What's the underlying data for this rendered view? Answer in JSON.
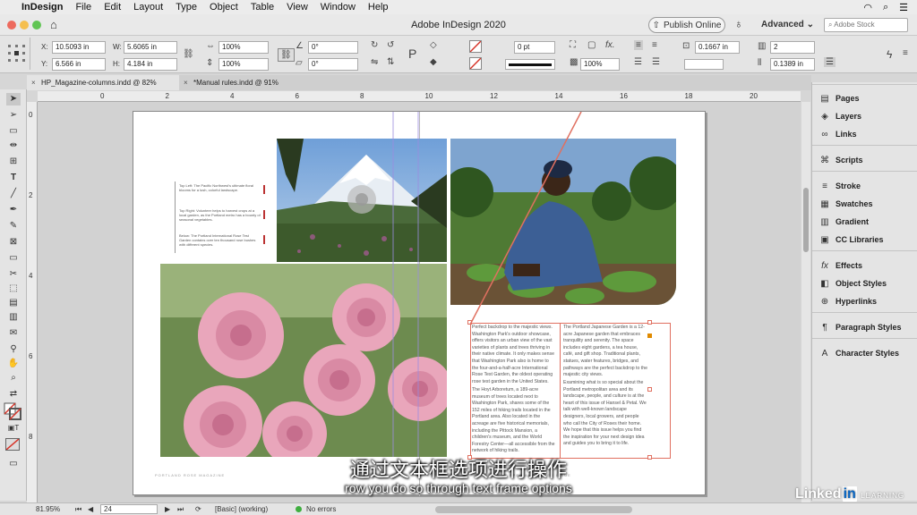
{
  "menubar": {
    "app": "InDesign",
    "items": [
      "File",
      "Edit",
      "Layout",
      "Type",
      "Object",
      "Table",
      "View",
      "Window",
      "Help"
    ]
  },
  "titlebar": {
    "title": "Adobe InDesign 2020",
    "publish_label": "Publish Online",
    "workspace": "Advanced",
    "stock_placeholder": "Adobe Stock"
  },
  "control": {
    "x_label": "X:",
    "x_value": "10.5093 in",
    "y_label": "Y:",
    "y_value": "6.566 in",
    "w_label": "W:",
    "w_value": "5.6065 in",
    "h_label": "H:",
    "h_value": "4.184 in",
    "scale_x": "100%",
    "scale_y": "100%",
    "rotate": "0°",
    "shear": "0°",
    "stroke_weight": "0 pt",
    "opacity": "100%",
    "inset_1": "0.1667 in",
    "inset_2": "0.1389 in",
    "columns": "2"
  },
  "tabs": [
    {
      "label": "HP_Magazine-columns.indd @ 82%",
      "active": true
    },
    {
      "label": "*Manual rules.indd @ 91%",
      "active": false
    }
  ],
  "rulers": {
    "h_ticks": [
      "0",
      "2",
      "4",
      "6",
      "8",
      "10",
      "12",
      "14",
      "16",
      "18",
      "20"
    ],
    "v_ticks": [
      "0",
      "2",
      "4",
      "6",
      "8"
    ]
  },
  "panels": [
    {
      "label": "Pages",
      "icon": "pages-icon",
      "glyph": "▤"
    },
    {
      "label": "Layers",
      "icon": "layers-icon",
      "glyph": "◈"
    },
    {
      "label": "Links",
      "icon": "links-icon",
      "glyph": "∞"
    },
    {
      "label": "Scripts",
      "icon": "scripts-icon",
      "glyph": "⌘"
    },
    {
      "label": "Stroke",
      "icon": "stroke-icon",
      "glyph": "≡"
    },
    {
      "label": "Swatches",
      "icon": "swatches-icon",
      "glyph": "▦"
    },
    {
      "label": "Gradient",
      "icon": "gradient-icon",
      "glyph": "▥"
    },
    {
      "label": "CC Libraries",
      "icon": "cc-libraries-icon",
      "glyph": "▣"
    },
    {
      "label": "Effects",
      "icon": "effects-icon",
      "glyph": "fx"
    },
    {
      "label": "Object Styles",
      "icon": "object-styles-icon",
      "glyph": "◧"
    },
    {
      "label": "Hyperlinks",
      "icon": "hyperlinks-icon",
      "glyph": "⊕"
    },
    {
      "label": "Paragraph Styles",
      "icon": "paragraph-styles-icon",
      "glyph": "¶"
    },
    {
      "label": "Character Styles",
      "icon": "character-styles-icon",
      "glyph": "A"
    }
  ],
  "page": {
    "left_text_1": "Perfect backdrop to the majestic views. Washington Park's outdoor showcase, offers visitors an urban view of the vast varieties of plants and trees thriving in their native climate. It only makes sense that Washington Park also is home to the four-and-a-half-acre International Rose Test Garden, the oldest operating rose test garden in the United States.",
    "left_text_2": "The Hoyt Arboretum, a 189-acre museum of trees located next to Washington Park, shares some of the 152 miles of hiking trails located in the Portland area. Also located in the acreage are five historical memorials, including the Pittock Mansion, a children's museum, and the World Forestry Center—all accessible from the network of hiking trails.",
    "right_text_1": "The Portland Japanese Garden is a 12-acre Japanese garden that embraces tranquility and serenity. The space includes eight gardens, a tea house, café, and gift shop. Traditional plants, statues, water features, bridges, and pathways are the perfect backdrop to the majestic city views.",
    "right_text_2": "Examining what is so special about the Portland metropolitan area and its landscape, people, and culture is at the heart of this issue of Hansel & Petal. We talk with well-known landscape designers, local growers, and people who call the City of Roses their home. We hope that this issue helps you find the inspiration for your next design idea and guides you to bring it to life.",
    "sidebar_1": "Top Left: The Pacific Northwest's ultimate floral blooms for a lush, colorful landscape.",
    "sidebar_2": "Top Right: Volunteer helps to harvest crops at a local garden, as the Portland metro has a bounty of seasonal vegetables.",
    "sidebar_3": "Below: The Portland International Rose Test Garden contains over ten thousand rose bushes with different species.",
    "folio_left": "PORTLAND ROSE MAGAZINE",
    "folio_right": "SPECIAL SUMMER ISSUE"
  },
  "status": {
    "zoom": "81.95%",
    "page": "24",
    "profile": "[Basic] (working)",
    "errors": "No errors"
  },
  "captions": {
    "cn": "通过文本框选项进行操作",
    "en": "row you do so through text frame options"
  },
  "watermark": {
    "brand": "Linked",
    "brand_in": "in",
    "suffix": "LEARNING"
  },
  "colors": {
    "traffic_red": "#ed6a5e",
    "traffic_yellow": "#f5bf4f",
    "traffic_green": "#61c554",
    "selection": "#e07060",
    "accent_red": "#d6352a"
  }
}
